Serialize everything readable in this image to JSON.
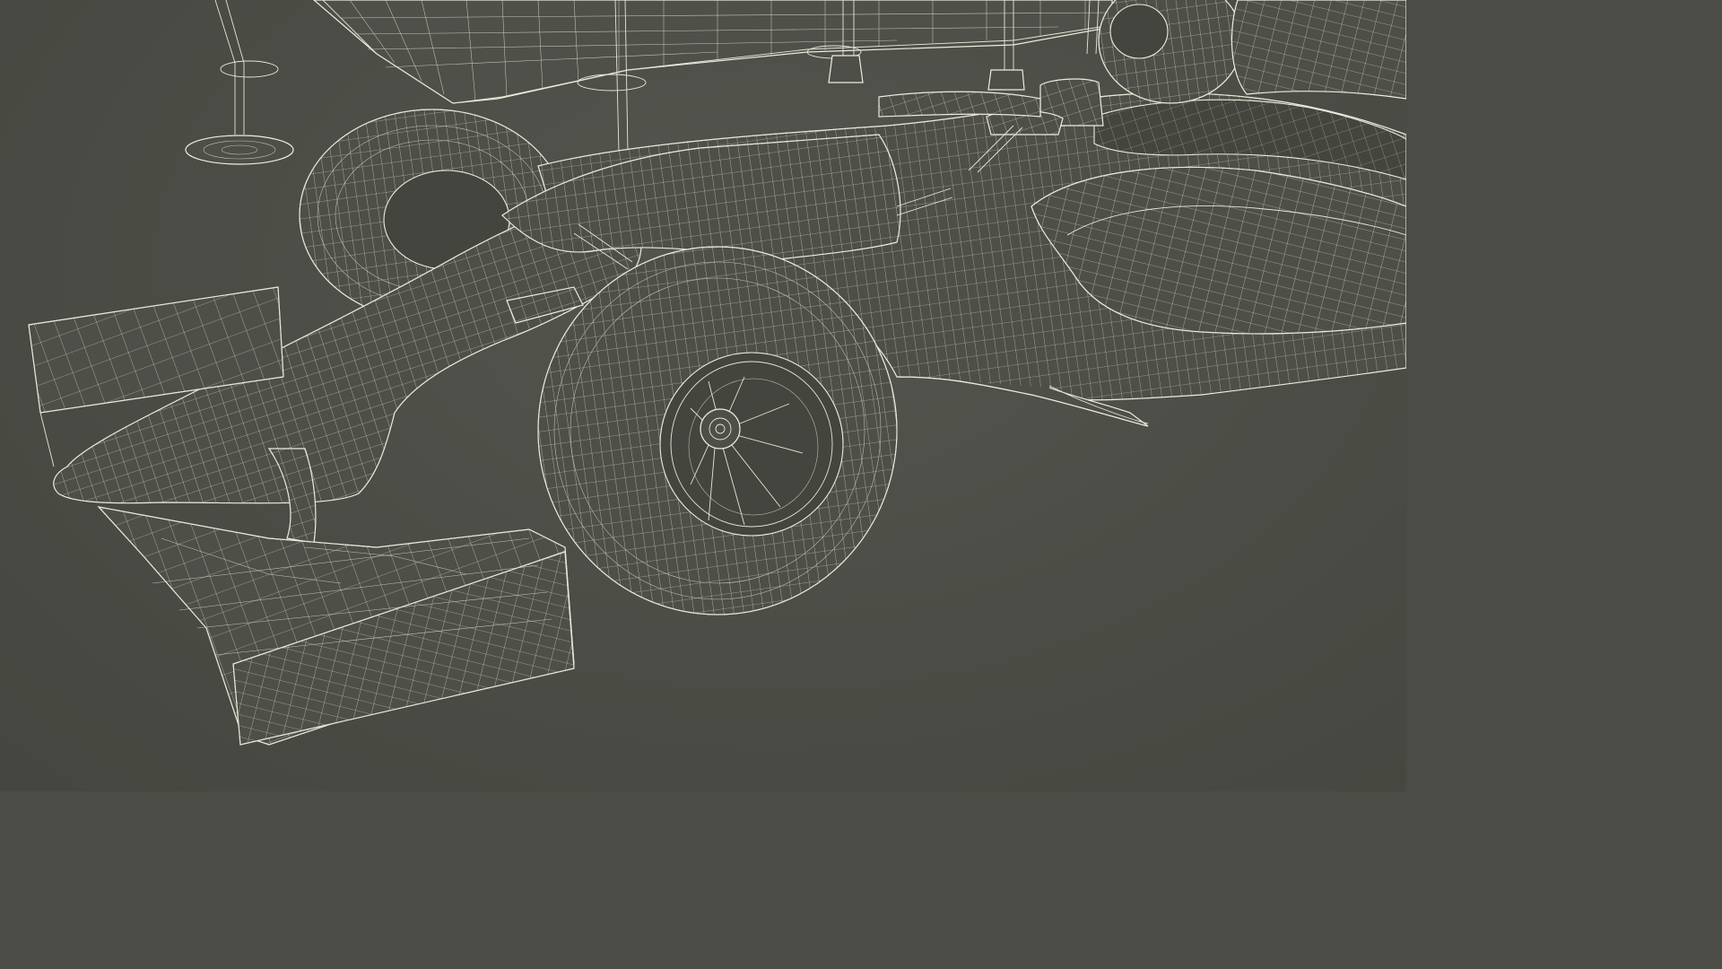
{
  "scene": {
    "subject": "formula-car-wireframe",
    "colors": {
      "background": "#4b4c45",
      "wire": "#e9e6d8",
      "surface": "#4e4f48"
    }
  }
}
